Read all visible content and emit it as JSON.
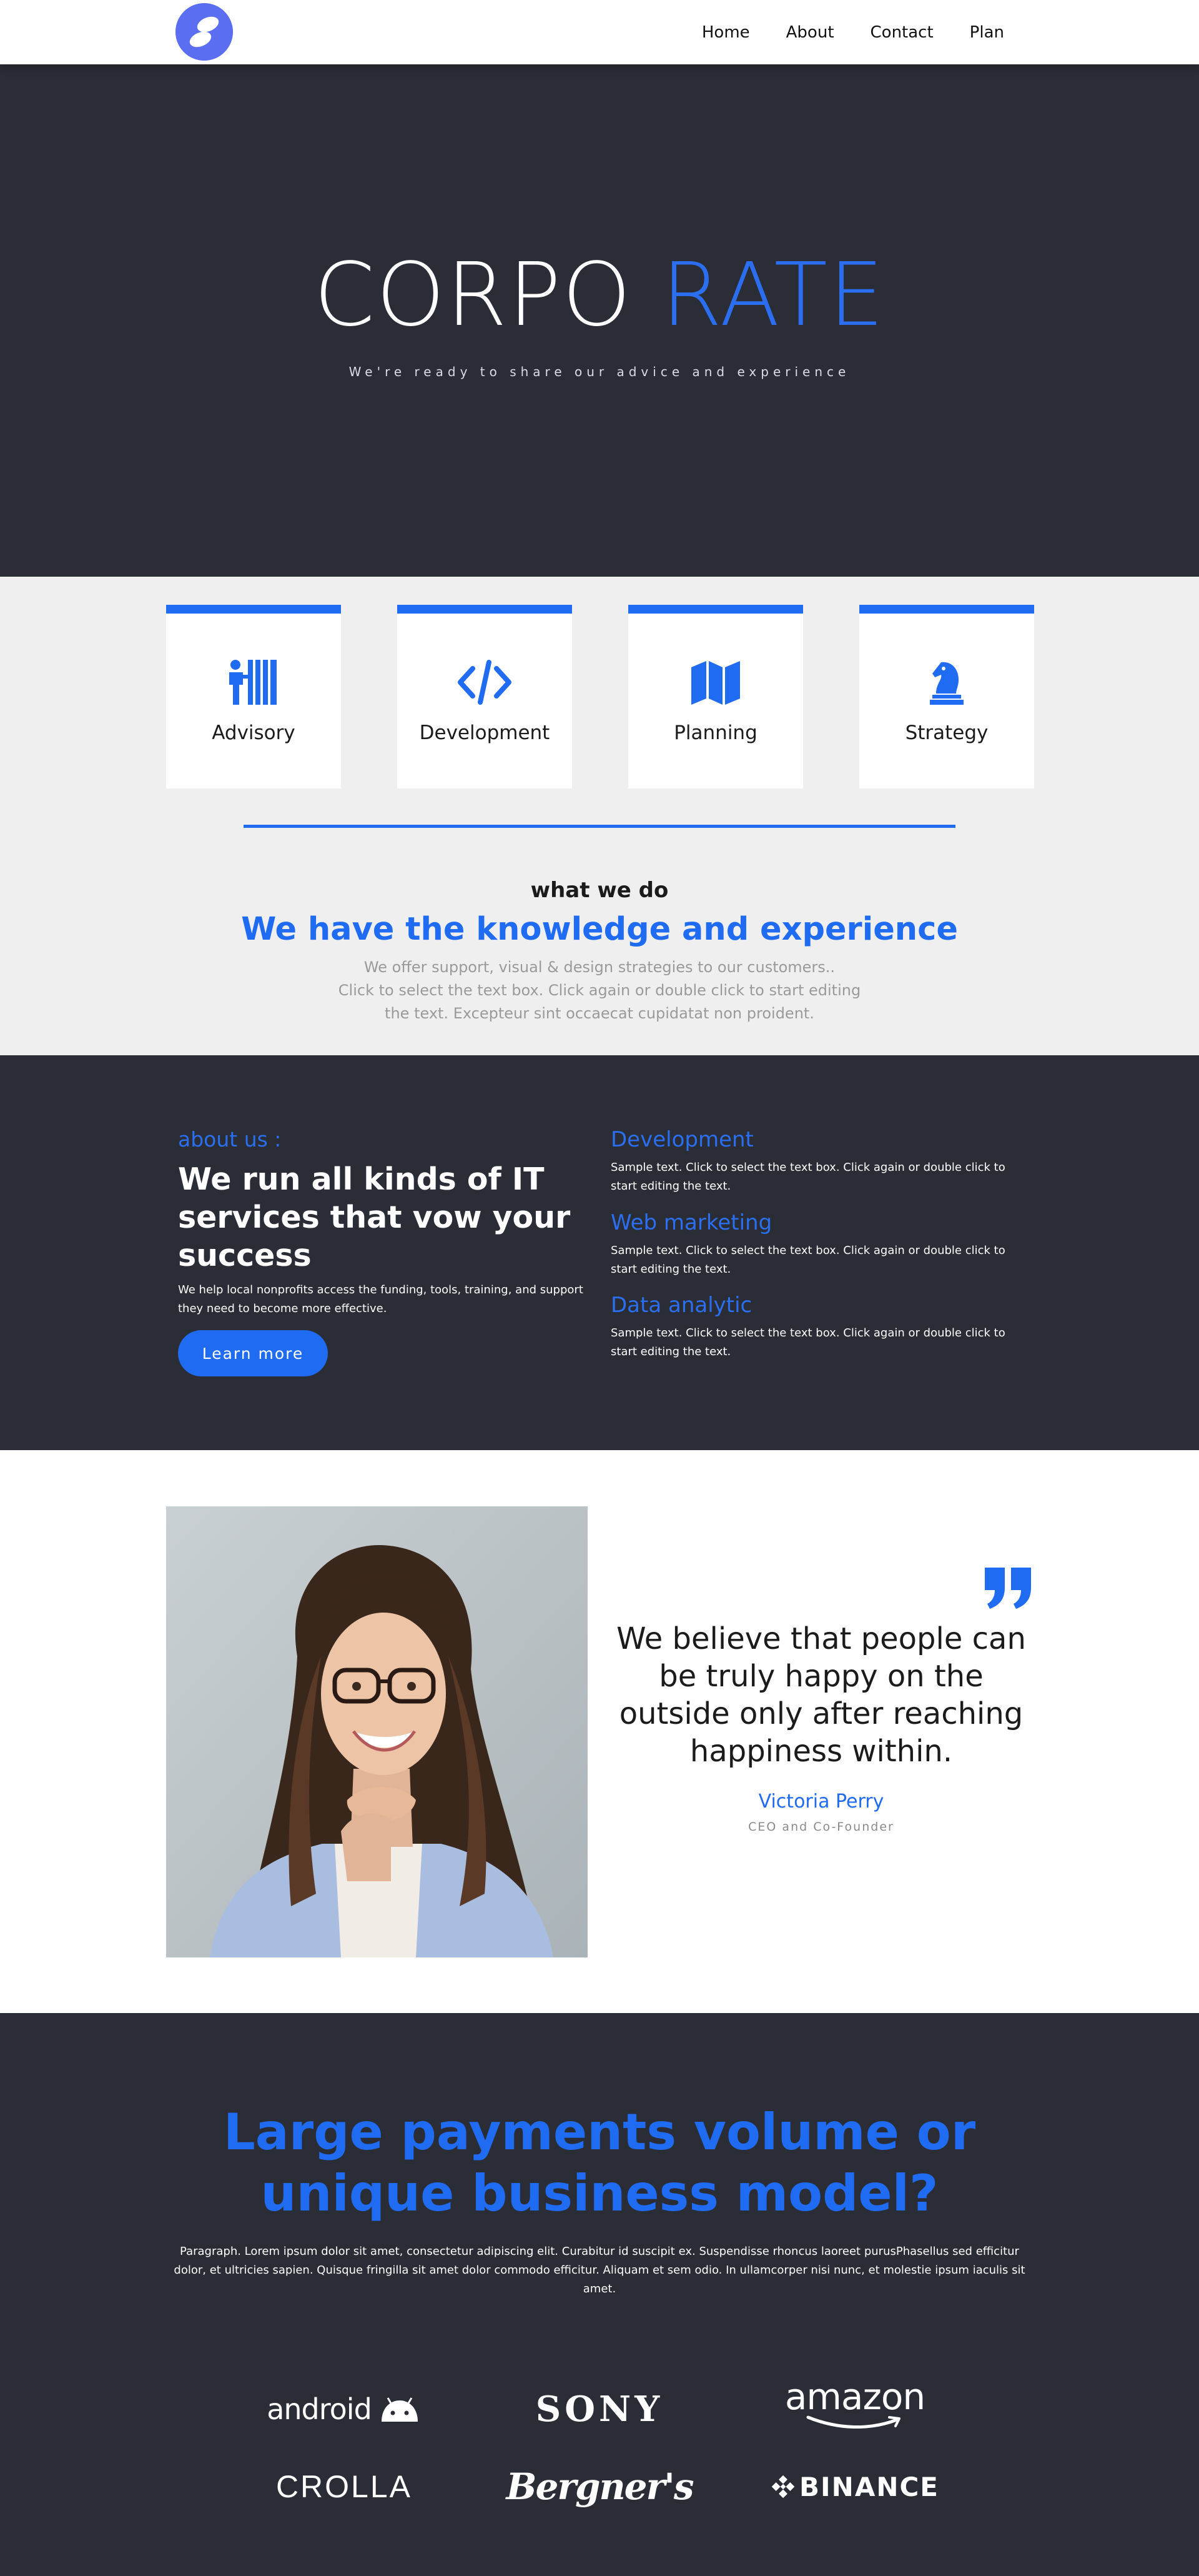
{
  "nav": {
    "links": [
      "Home",
      "About",
      "Contact",
      "Plan"
    ]
  },
  "hero": {
    "title_part1": "CORPO",
    "title_part2": "RATE",
    "subtitle": "We're ready to share our advice and experience"
  },
  "services": {
    "cards": [
      {
        "label": "Advisory",
        "icon": "advisory-icon"
      },
      {
        "label": "Development",
        "icon": "code-icon"
      },
      {
        "label": "Planning",
        "icon": "map-icon"
      },
      {
        "label": "Strategy",
        "icon": "chess-knight-icon"
      }
    ],
    "kicker": "what we do",
    "title": "We have the knowledge and experience",
    "text_lines": [
      "We offer support, visual & design strategies to our customers..",
      "Click to select the text box. Click again or double click to start editing",
      "the text. Excepteur sint occaecat cupidatat non proident."
    ]
  },
  "about": {
    "kicker": "about us :",
    "title": "We run all kinds of IT services that vow your success",
    "text": "We help local nonprofits access the funding, tools, training, and support they need to become more effective.",
    "button": "Learn more",
    "features": [
      {
        "title": "Development",
        "text": "Sample text. Click to select the text box. Click again or double click to start editing the text."
      },
      {
        "title": "Web marketing",
        "text": "Sample text. Click to select the text box. Click again or double click to start editing the text."
      },
      {
        "title": "Data analytic",
        "text": "Sample text. Click to select the text box. Click again or double click to start editing the text."
      }
    ]
  },
  "testimonial": {
    "quote": "We believe that people can be truly happy on the outside only after reaching happiness within.",
    "name": "Victoria Perry",
    "role": "CEO and Co-Founder"
  },
  "payments": {
    "title": "Large payments volume or unique business model?",
    "text": "Paragraph. Lorem ipsum dolor sit amet, consectetur adipiscing elit. Curabitur id suscipit ex. Suspendisse rhoncus laoreet purusPhasellus sed efficitur dolor, et ultricies sapien. Quisque fringilla sit amet dolor commodo efficitur. Aliquam et sem odio. In ullamcorper nisi nunc, et molestie ipsum iaculis sit amet.",
    "brands": [
      "android",
      "SONY",
      "amazon",
      "CROLLA",
      "Bergner's",
      "BINANCE"
    ]
  },
  "colors": {
    "accent": "#1f6bf2",
    "dark": "#2a2d36",
    "light": "#efefef",
    "logo": "#5b6df0"
  }
}
